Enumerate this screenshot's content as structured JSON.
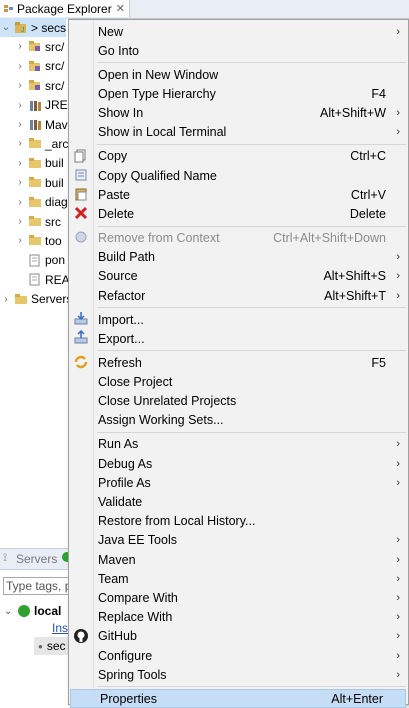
{
  "package_explorer": {
    "tab_label": "Package Explorer",
    "close_glyph": "✕",
    "tree": [
      {
        "label": "> secs",
        "expanded": true,
        "indent": 0,
        "icon": "project-icon",
        "selected": true
      },
      {
        "label": "src/",
        "indent": 1,
        "icon": "source-folder-icon"
      },
      {
        "label": "src/",
        "indent": 1,
        "icon": "source-folder-icon"
      },
      {
        "label": "src/",
        "indent": 1,
        "icon": "source-folder-icon"
      },
      {
        "label": "JRE",
        "indent": 1,
        "icon": "library-icon"
      },
      {
        "label": "Mav",
        "indent": 1,
        "icon": "library-icon"
      },
      {
        "label": "_arc",
        "indent": 1,
        "icon": "folder-icon"
      },
      {
        "label": "buil",
        "indent": 1,
        "icon": "folder-icon"
      },
      {
        "label": "buil",
        "indent": 1,
        "icon": "folder-icon"
      },
      {
        "label": "diag",
        "indent": 1,
        "icon": "folder-icon"
      },
      {
        "label": "src",
        "indent": 1,
        "icon": "folder-icon"
      },
      {
        "label": "too",
        "indent": 1,
        "icon": "folder-icon"
      },
      {
        "label": "pon",
        "indent": 1,
        "icon": "file-icon",
        "leaf": true
      },
      {
        "label": "REA",
        "indent": 1,
        "icon": "file-icon",
        "leaf": true
      },
      {
        "label": "Servers",
        "indent": 0,
        "icon": "folder-icon"
      }
    ]
  },
  "servers_panel": {
    "tab_label": "Servers",
    "search_placeholder": "Type tags, p",
    "server_name": "local",
    "server_link": "Ins",
    "server_child": "sec"
  },
  "context_menu": {
    "items": [
      {
        "label": "New",
        "submenu": true
      },
      {
        "label": "Go Into"
      },
      {
        "sep": true
      },
      {
        "label": "Open in New Window"
      },
      {
        "label": "Open Type Hierarchy",
        "shortcut": "F4"
      },
      {
        "label": "Show In",
        "shortcut": "Alt+Shift+W",
        "submenu": true
      },
      {
        "label": "Show in Local Terminal",
        "submenu": true
      },
      {
        "sep": true
      },
      {
        "label": "Copy",
        "shortcut": "Ctrl+C",
        "icon": "copy-icon"
      },
      {
        "label": "Copy Qualified Name",
        "icon": "copy-qualified-icon"
      },
      {
        "label": "Paste",
        "shortcut": "Ctrl+V",
        "icon": "paste-icon"
      },
      {
        "label": "Delete",
        "shortcut": "Delete",
        "icon": "delete-icon"
      },
      {
        "sep": true
      },
      {
        "label": "Remove from Context",
        "shortcut": "Ctrl+Alt+Shift+Down",
        "disabled": true,
        "icon": "remove-context-icon"
      },
      {
        "label": "Build Path",
        "submenu": true
      },
      {
        "label": "Source",
        "shortcut": "Alt+Shift+S",
        "submenu": true
      },
      {
        "label": "Refactor",
        "shortcut": "Alt+Shift+T",
        "submenu": true
      },
      {
        "sep": true
      },
      {
        "label": "Import...",
        "icon": "import-icon"
      },
      {
        "label": "Export...",
        "icon": "export-icon"
      },
      {
        "sep": true
      },
      {
        "label": "Refresh",
        "shortcut": "F5",
        "icon": "refresh-icon"
      },
      {
        "label": "Close Project"
      },
      {
        "label": "Close Unrelated Projects"
      },
      {
        "label": "Assign Working Sets..."
      },
      {
        "sep": true
      },
      {
        "label": "Run As",
        "submenu": true
      },
      {
        "label": "Debug As",
        "submenu": true
      },
      {
        "label": "Profile As",
        "submenu": true
      },
      {
        "label": "Validate"
      },
      {
        "label": "Restore from Local History..."
      },
      {
        "label": "Java EE Tools",
        "submenu": true
      },
      {
        "label": "Maven",
        "submenu": true
      },
      {
        "label": "Team",
        "submenu": true
      },
      {
        "label": "Compare With",
        "submenu": true
      },
      {
        "label": "Replace With",
        "submenu": true
      },
      {
        "label": "GitHub",
        "submenu": true,
        "icon": "github-icon"
      },
      {
        "label": "Configure",
        "submenu": true
      },
      {
        "label": "Spring Tools",
        "submenu": true
      },
      {
        "sep": true
      },
      {
        "label": "Properties",
        "shortcut": "Alt+Enter",
        "highlighted": true
      }
    ]
  },
  "colors": {
    "menu_bg": "#f2f2f2",
    "highlight": "#c6def5",
    "selection": "#cde3f8",
    "disabled_text": "#8c8c8c"
  },
  "glyphs": {
    "submenu_arrow": "›",
    "expand": "⌄",
    "collapse": "›"
  }
}
